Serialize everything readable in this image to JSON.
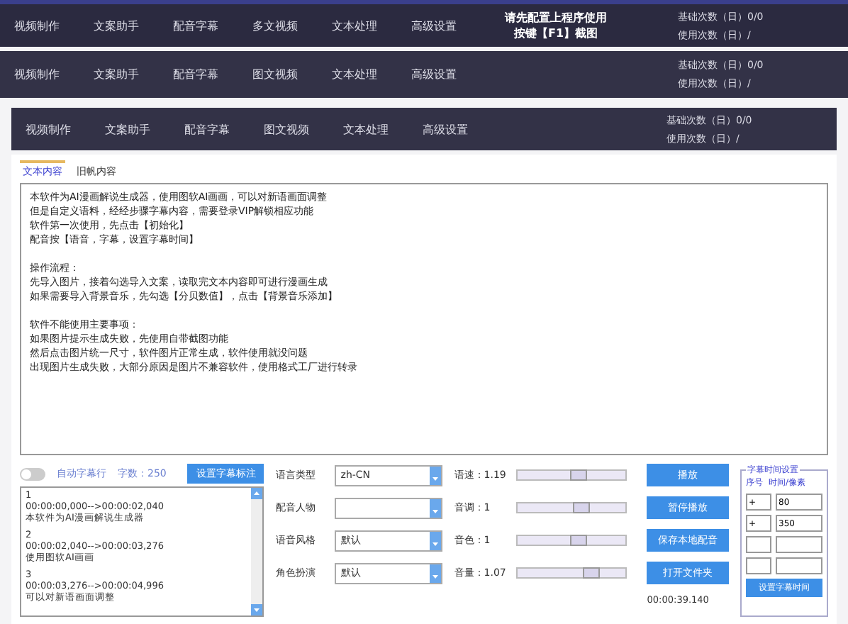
{
  "nav_bars": [
    {
      "items": [
        "视频制作",
        "文案助手",
        "配音字幕",
        "多文视频",
        "文本处理",
        "高级设置"
      ],
      "notice": [
        "请先配置上程序使用",
        "按键【F1】截图"
      ],
      "stats": [
        "基础次数（日）0/0",
        "使用次数（日）/"
      ]
    },
    {
      "items": [
        "视频制作",
        "文案助手",
        "配音字幕",
        "图文视频",
        "文本处理",
        "高级设置"
      ],
      "stats": [
        "基础次数（日）0/0",
        "使用次数（日）/"
      ]
    },
    {
      "items": [
        "视频制作",
        "文案助手",
        "配音字幕",
        "图文视频",
        "文本处理",
        "高级设置"
      ],
      "stats": [
        "基础次数（日）0/0",
        "使用次数（日）/"
      ]
    }
  ],
  "tabs": [
    {
      "label": "文本内容",
      "selected": true
    },
    {
      "label": "旧帆内容",
      "selected": false
    }
  ],
  "text_content": [
    [
      "本软件为AI漫画解说生成器，使用图软AI画画，可以对新语画面调整",
      "但是自定义语料，经经步骤字幕内容，需要登录VIP解锁相应功能",
      "软件第一次使用，先点击【初始化】",
      "配音按【语音，字幕，设置字幕时间】"
    ],
    [
      "操作流程：",
      "先导入图片，接着勾选导入文案，读取完文本内容即可进行漫画生成",
      "如果需要导入背景音乐，先勾选【分贝数值】，点击【背景音乐添加】"
    ],
    [
      "软件不能使用主要事项：",
      "如果图片提示生成失败，先使用自带截图功能",
      "然后点击图片统一尺寸，软件图片正常生成，软件使用就没问题",
      "出现图片生成失败，大部分原因是图片不兼容软件，使用格式工厂进行转录"
    ]
  ],
  "subtitle_toggle": {
    "label": "自动字幕行",
    "on": false
  },
  "char_count": "字数：250",
  "mark_button": "设置字幕标注",
  "subtitles": [
    [
      "1",
      "00:00:00,000-->00:00:02,040",
      "本软件为AI漫画解说生成器"
    ],
    [
      "2",
      "00:00:02,040-->00:00:03,276",
      "使用图软AI画画"
    ],
    [
      "3",
      "00:00:03,276-->00:00:04,996",
      "可以对新语画面调整"
    ]
  ],
  "selects": [
    {
      "label": "语言类型",
      "value": "zh-CN"
    },
    {
      "label": "配音人物"
    },
    {
      "label": "语音风格",
      "value": "默认"
    },
    {
      "label": "角色扮演",
      "value": "默认"
    }
  ],
  "sliders": [
    {
      "reading": "语速：1.19",
      "level": 0.55
    },
    {
      "reading": "音调：1",
      "level": 0.58
    },
    {
      "reading": "音色：1",
      "level": 0.55
    },
    {
      "reading": "音量：1.07",
      "level": 0.7
    }
  ],
  "buttons": [
    "播放",
    "暂停播放",
    "保存本地配音",
    "打开文件夹"
  ],
  "time": "00:00:39.140",
  "timing": {
    "title": "字幕时间设置",
    "headers": [
      "序号",
      "时间/像素"
    ],
    "rows": [
      [
        "+",
        "80"
      ],
      [
        "+",
        "350"
      ],
      [
        "",
        ""
      ],
      [
        "",
        ""
      ]
    ],
    "button": "设置字幕时间"
  }
}
